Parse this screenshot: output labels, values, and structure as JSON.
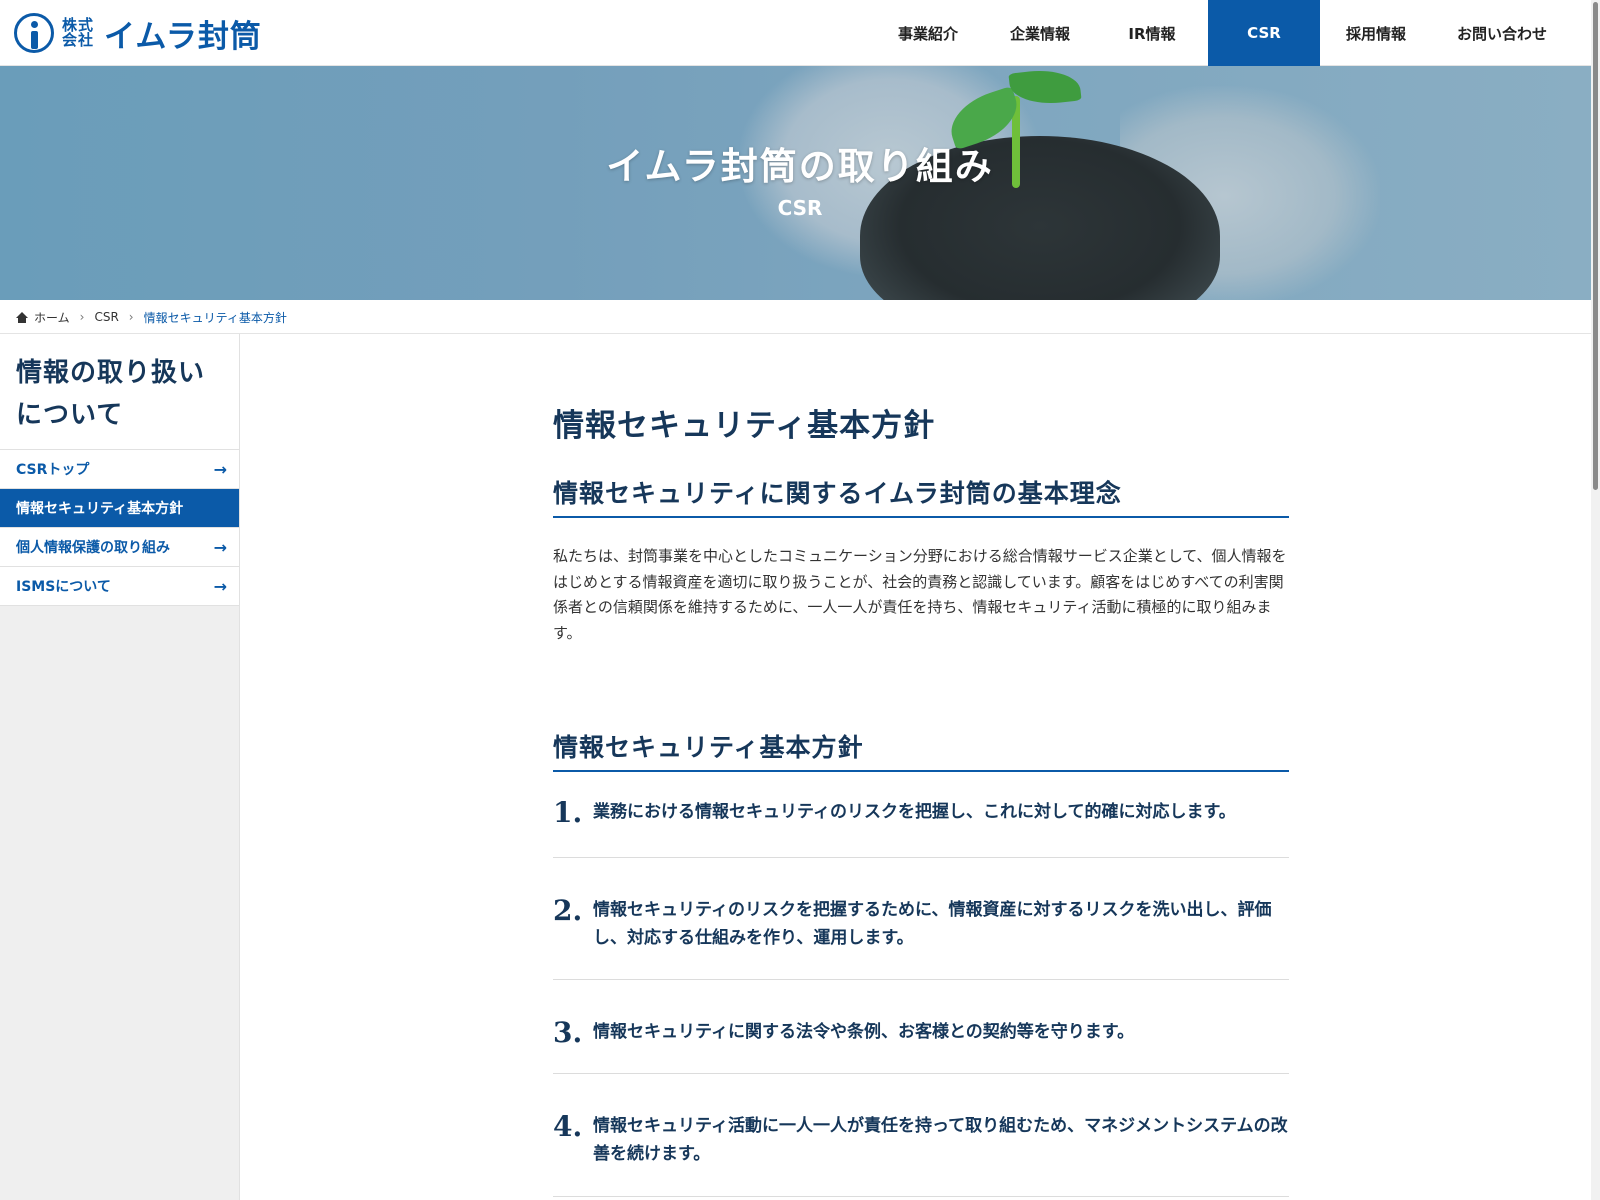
{
  "header": {
    "logo_kk": "株式会社",
    "logo_name": "イムラ封筒",
    "nav": [
      "事業紹介",
      "企業情報",
      "IR情報",
      "CSR",
      "採用情報",
      "お問い合わせ"
    ],
    "active_nav": "CSR"
  },
  "hero": {
    "title": "イムラ封筒の取り組み",
    "subtitle": "CSR"
  },
  "breadcrumb": {
    "home": "ホーム",
    "csr": "CSR",
    "current": "情報セキュリティ基本方針"
  },
  "sidebar": {
    "title_line1": "情報の取り扱い",
    "title_line2": "について",
    "items": [
      {
        "label": "CSRトップ"
      },
      {
        "label": "情報セキュリティ基本方針"
      },
      {
        "label": "個人情報保護の取り組み"
      },
      {
        "label": "ISMSについて"
      }
    ]
  },
  "main": {
    "page_title": "情報セキュリティ基本方針",
    "section1_title": "情報セキュリティに関するイムラ封筒の基本理念",
    "lead": "私たちは、封筒事業を中心としたコミュニケーション分野における総合情報サービス企業として、個人情報をはじめとする情報資産を適切に取り扱うことが、社会的責務と認識しています。顧客をはじめすべての利害関係者との信頼関係を維持するために、一人一人が責任を持ち、情報セキュリティ活動に積極的に取り組みます。",
    "section2_title": "情報セキュリティ基本方針",
    "policies": [
      {
        "num": "1.",
        "text": "業務における情報セキュリティのリスクを把握し、これに対して的確に対応します。"
      },
      {
        "num": "2.",
        "text": "情報セキュリティのリスクを把握するために、情報資産に対するリスクを洗い出し、評価し、対応する仕組みを作り、運用します。"
      },
      {
        "num": "3.",
        "text": "情報セキュリティに関する法令や条例、お客様との契約等を守ります。"
      },
      {
        "num": "4.",
        "text": "情報セキュリティ活動に一人一人が責任を持って取り組むため、マネジメントシステムの改善を続けます。"
      }
    ]
  },
  "colors": {
    "brand_blue": "#0b5aa8",
    "heading_navy": "#16375a"
  },
  "icons": {
    "home": "home-icon",
    "chevron": "chevron-right-icon",
    "arrow": "arrow-right-icon"
  }
}
